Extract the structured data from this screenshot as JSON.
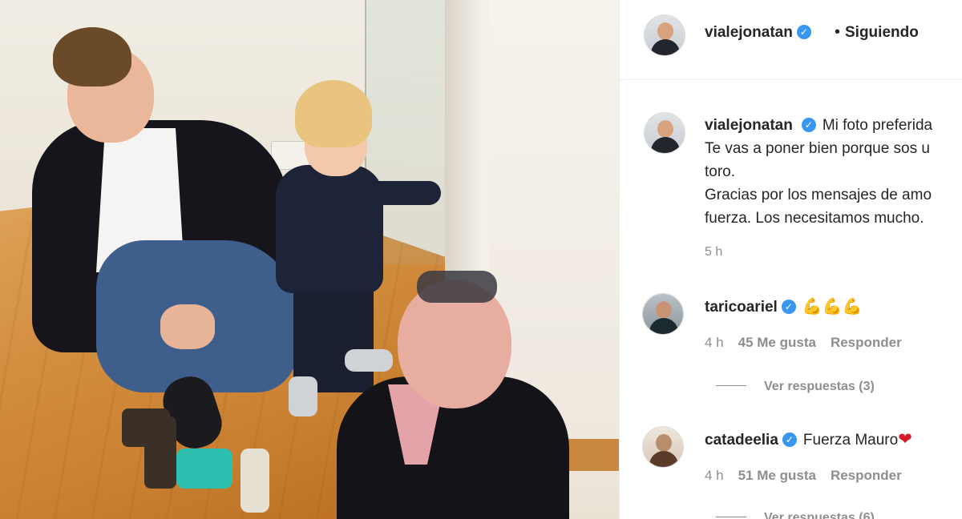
{
  "post": {
    "author": "vialejonatan",
    "follow_state": "Siguiendo",
    "caption_lines": [
      "Mi foto preferida",
      "Te vas a poner bien porque sos u",
      "toro.",
      "Gracias por los mensajes de amo",
      "fuerza. Los necesitamos mucho."
    ],
    "time": "5 h"
  },
  "comments": [
    {
      "user": "taricoariel",
      "text": "💪💪💪",
      "time": "4 h",
      "likes": "45 Me gusta",
      "reply": "Responder",
      "view_replies": "Ver respuestas (3)"
    },
    {
      "user": "catadeelia",
      "text": "Fuerza Mauro",
      "emoji": "❤",
      "time": "4 h",
      "likes": "51 Me gusta",
      "reply": "Responder",
      "view_replies": "Ver respuestas (6)"
    }
  ],
  "icons": {
    "verified": "verified-badge-icon",
    "separator_dot": "•"
  },
  "colors": {
    "verified_blue": "#3897f0",
    "muted_text": "#8e8e8e",
    "primary_text": "#262626",
    "heart_red": "#d61b2a"
  }
}
